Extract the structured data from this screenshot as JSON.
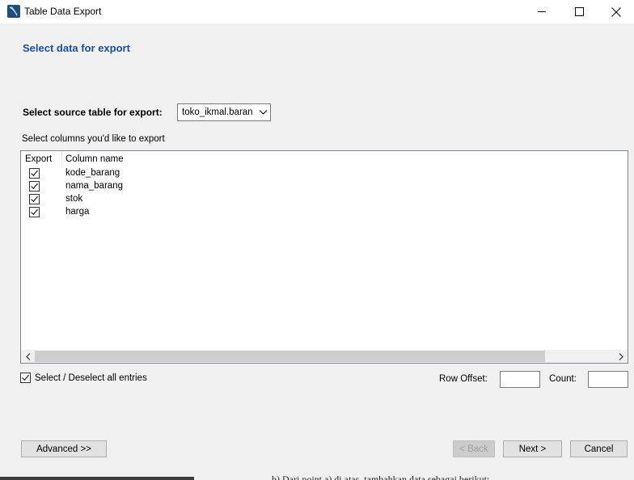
{
  "window": {
    "title": "Table Data Export"
  },
  "page": {
    "heading": "Select data for export"
  },
  "source": {
    "label": "Select source table for export:",
    "selected": "toko_ikmal.baran"
  },
  "columns": {
    "label": "Select columns you'd like to export",
    "header_export": "Export",
    "header_name": "Column name",
    "rows": [
      {
        "name": "kode_barang",
        "checked": true
      },
      {
        "name": "nama_barang",
        "checked": true
      },
      {
        "name": "stok",
        "checked": true
      },
      {
        "name": "harga",
        "checked": true
      }
    ]
  },
  "select_all": {
    "label": "Select / Deselect all entries",
    "checked": true
  },
  "row_offset": {
    "label": "Row Offset:",
    "value": ""
  },
  "count": {
    "label": "Count:",
    "value": ""
  },
  "buttons": {
    "advanced": "Advanced >>",
    "back": "< Back",
    "next": "Next >",
    "cancel": "Cancel"
  },
  "background_text": "b) Dari point a) di atas, tambahkan data sebagai berikut:"
}
